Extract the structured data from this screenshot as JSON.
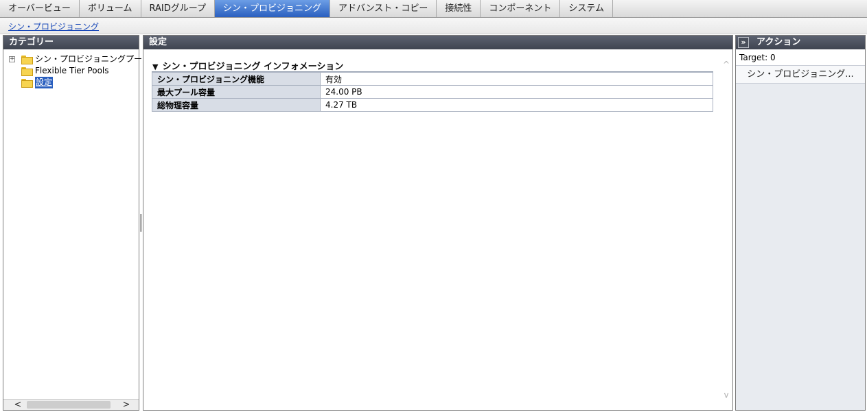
{
  "tabs": [
    {
      "label": "オーバービュー",
      "active": false
    },
    {
      "label": "ボリューム",
      "active": false
    },
    {
      "label": "RAIDグループ",
      "active": false
    },
    {
      "label": "シン・プロビジョニング",
      "active": true
    },
    {
      "label": "アドバンスト・コピー",
      "active": false
    },
    {
      "label": "接続性",
      "active": false
    },
    {
      "label": "コンポーネント",
      "active": false
    },
    {
      "label": "システム",
      "active": false
    }
  ],
  "breadcrumb": "シン・プロビジョニング",
  "category": {
    "title": "カテゴリー",
    "items": [
      {
        "label": "シン・プロビジョニングプー",
        "expandable": true,
        "expander": "+"
      },
      {
        "label": "Flexible Tier Pools",
        "expandable": false
      },
      {
        "label": "設定",
        "expandable": false,
        "selected": true
      }
    ],
    "scroll_left": "<",
    "scroll_right": ">"
  },
  "main": {
    "title": "設定",
    "section_toggle": "▼",
    "section_title": "シン・プロビジョニング インフォメーション",
    "rows": [
      {
        "key": "シン・プロビジョニング機能",
        "value": "有効"
      },
      {
        "key": "最大プール容量",
        "value": "24.00 PB"
      },
      {
        "key": "総物理容量",
        "value": "4.27 TB"
      }
    ],
    "scroll_up": "^",
    "scroll_down": "v"
  },
  "actions": {
    "title": "アクション",
    "collapse": "»",
    "target_label": "Target:",
    "target_value": "0",
    "buttons": [
      "シン・プロビジョニング..."
    ]
  }
}
